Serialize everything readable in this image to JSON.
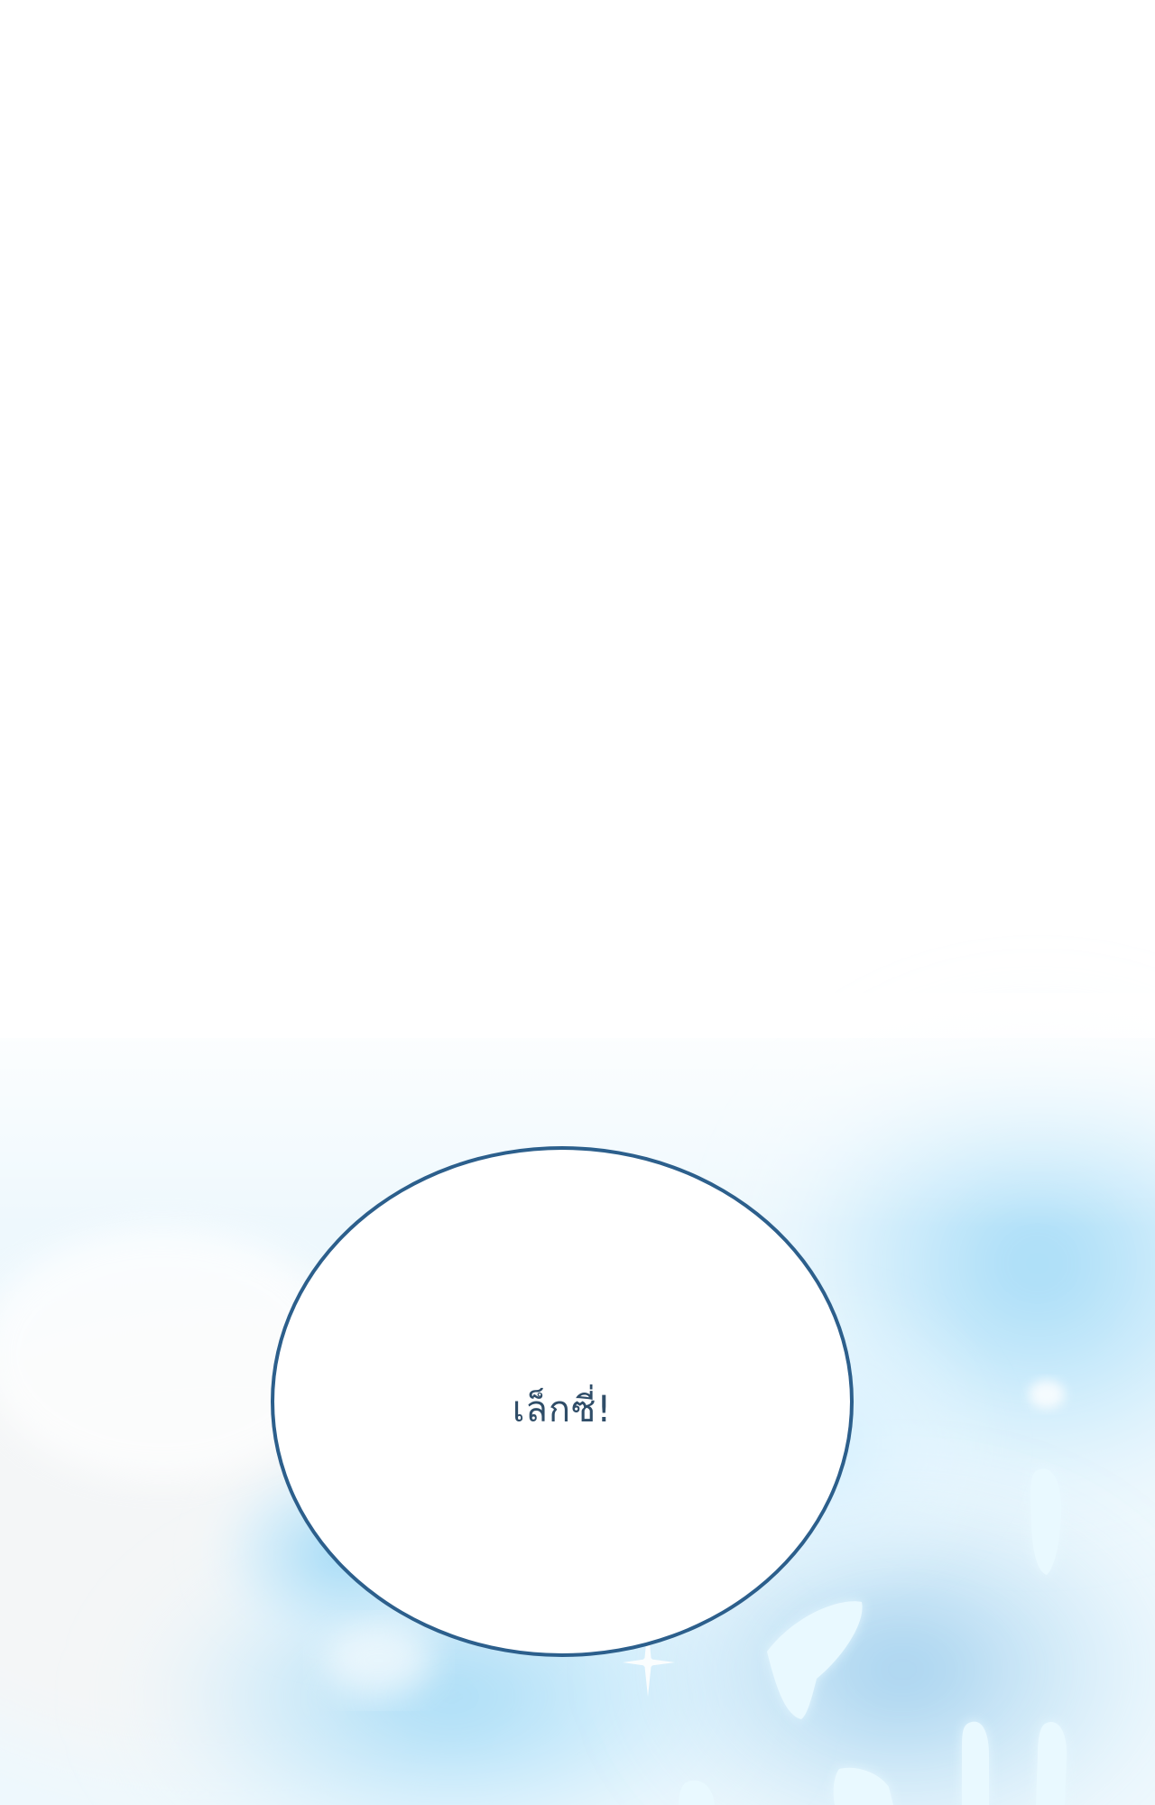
{
  "comic_panel": {
    "speech_bubble": {
      "text": "เล็กซี่!"
    }
  },
  "colors": {
    "background": "#ffffff",
    "glow_light": "#cfeeff",
    "glow_mid": "#8fd3f5",
    "glow_deep": "#5aa8de",
    "bubble_outline": "#2c5f8c",
    "text": "#2f4d68"
  }
}
